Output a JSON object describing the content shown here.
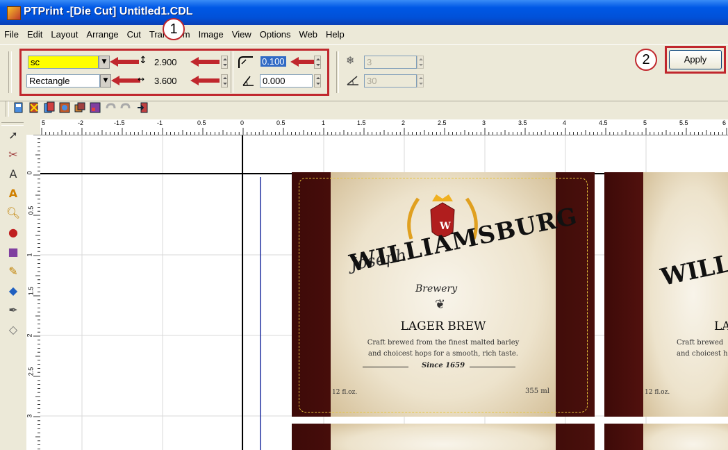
{
  "window": {
    "title": "PTPrint -[Die Cut] Untitled1.CDL"
  },
  "menu": [
    "File",
    "Edit",
    "Layout",
    "Arrange",
    "Cut",
    "Transform",
    "Image",
    "View",
    "Options",
    "Web",
    "Help"
  ],
  "property_bar": {
    "color_combo": {
      "value": "sc",
      "color": "#ffff00"
    },
    "shape_combo": {
      "value": "Rectangle"
    },
    "height": {
      "value": "2.900",
      "icon": "height-icon"
    },
    "width": {
      "value": "3.600",
      "icon": "width-icon"
    },
    "corner_radius": {
      "value": "0.100",
      "icon": "corner-radius-icon"
    },
    "angle": {
      "value": "0.000",
      "icon": "angle-icon"
    },
    "count": {
      "value": "3",
      "icon": "snowflake-icon"
    },
    "rotation": {
      "value": "30",
      "icon": "rotate-icon"
    },
    "apply_label": "Apply"
  },
  "callouts": [
    "1",
    "2"
  ],
  "ruler_h": [
    "5",
    "-2",
    "-1.5",
    "-1",
    "0.5",
    "0",
    "0.5",
    "1",
    "1.5",
    "2",
    "2.5",
    "3",
    "3.5",
    "4",
    "4.5",
    "5",
    "5.5",
    "6"
  ],
  "ruler_v": [
    "0",
    "0.5",
    "1",
    "1.5",
    "2",
    "2.5",
    "3"
  ],
  "label": {
    "signature": "Joseph",
    "brand": "WILLIAMSBURG",
    "sub": "Brewery",
    "product": "LAGER BREW",
    "desc1": "Craft brewed from the finest malted barley",
    "desc2": "and choicest hops for a smooth, rich taste.",
    "since": "Since 1659",
    "volume_left": "12 fl.oz.",
    "volume_right": "355 ml",
    "crest_letter": "W"
  },
  "label2": {
    "brand": "WILL",
    "product": "LA",
    "desc1": "Craft brewed",
    "desc2": "and choicest h",
    "volume_left": "12 fl.oz."
  },
  "colors": {
    "highlight_red": "#c0272d",
    "title_blue": "#0058e6"
  }
}
